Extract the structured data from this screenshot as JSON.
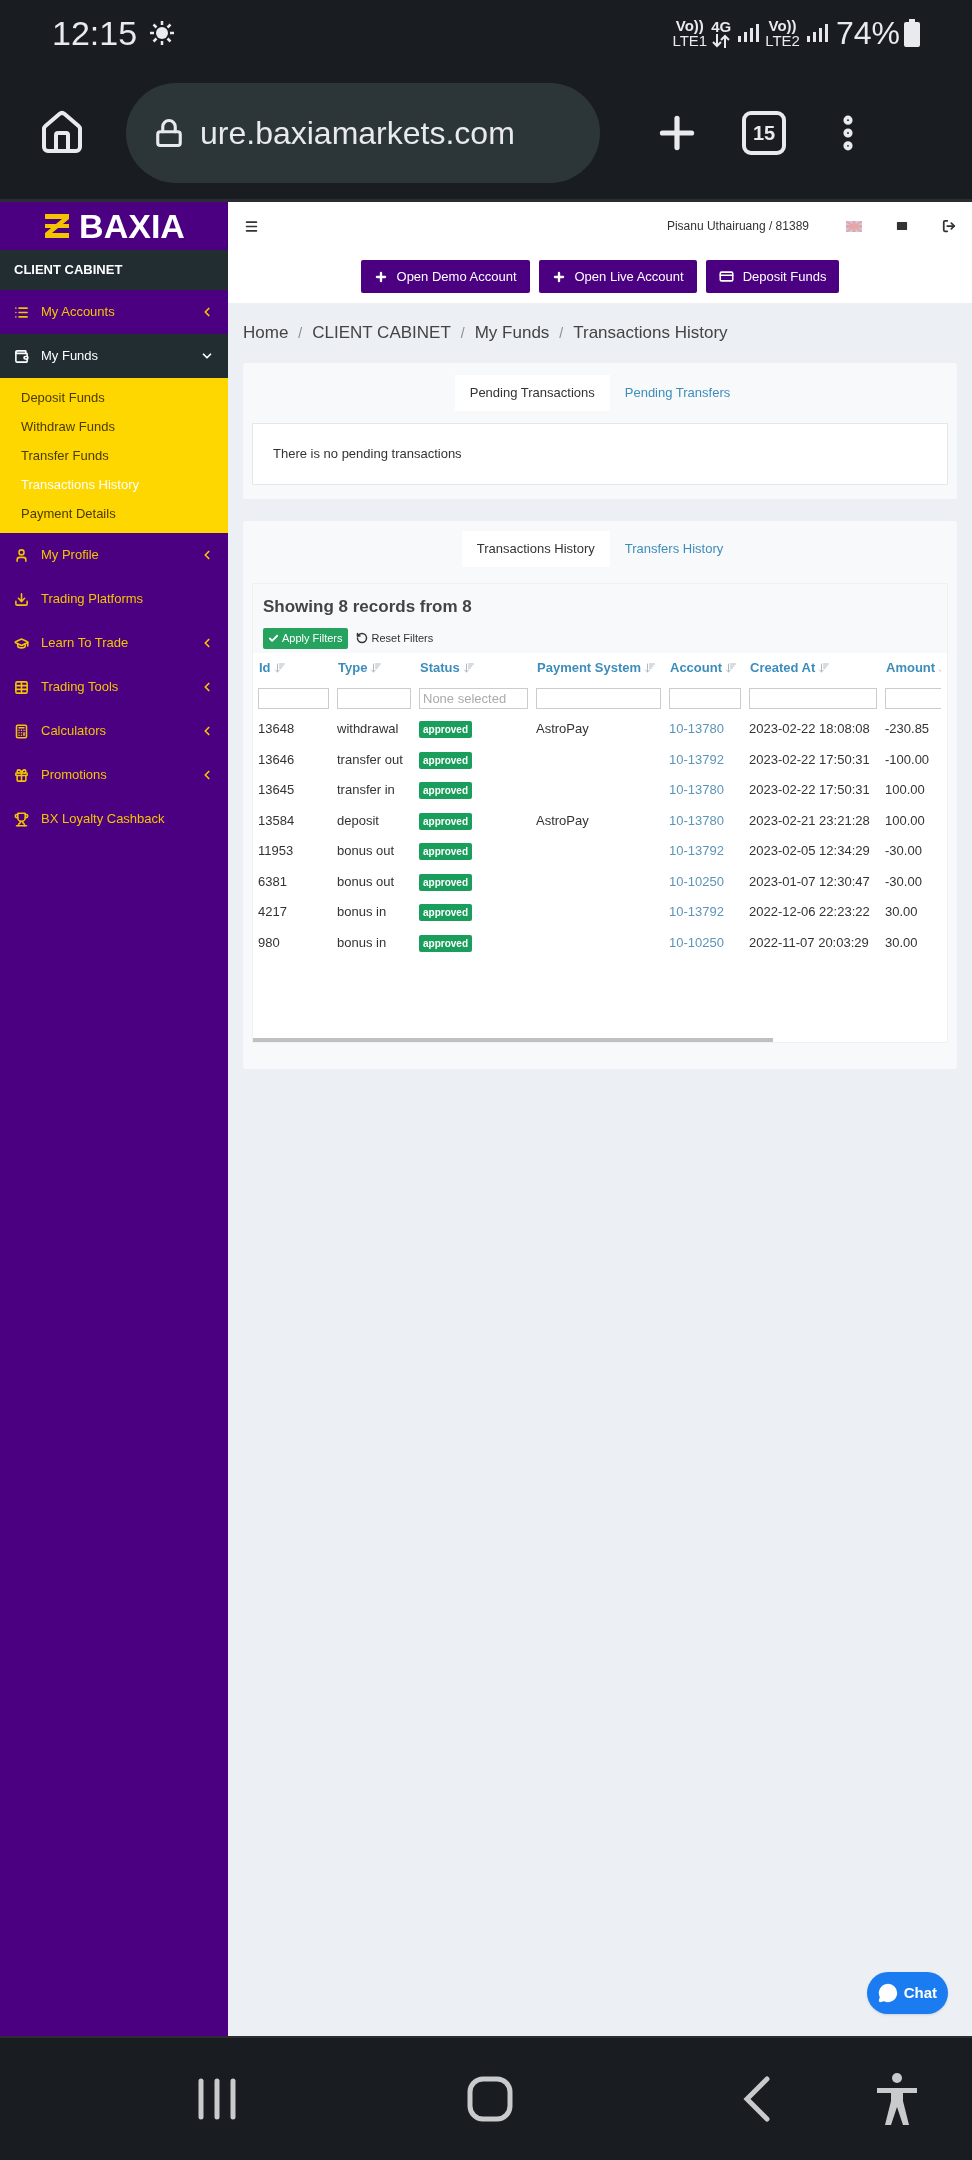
{
  "status_bar": {
    "time": "12:15",
    "indicators": [
      {
        "kind": "volte",
        "top": "Vo))",
        "bottom": "LTE1"
      },
      {
        "kind": "data",
        "top": "4G"
      },
      {
        "kind": "volte",
        "top": "Vo))",
        "bottom": "LTE2"
      }
    ],
    "battery": "74%"
  },
  "browser": {
    "url": "ure.baxiamarkets.com",
    "tab_count": "15"
  },
  "sidebar": {
    "logo": "BAXIA",
    "section": "CLIENT CABINET",
    "items": [
      {
        "kind": "group",
        "label": "My Accounts",
        "expanded": false
      },
      {
        "kind": "group",
        "label": "My Funds",
        "expanded": true,
        "children": [
          {
            "label": "Deposit Funds",
            "selected": false
          },
          {
            "label": "Withdraw Funds",
            "selected": false
          },
          {
            "label": "Transfer Funds",
            "selected": false
          },
          {
            "label": "Transactions History",
            "selected": true
          },
          {
            "label": "Payment Details",
            "selected": false
          }
        ]
      },
      {
        "kind": "group",
        "label": "My Profile",
        "expanded": false
      },
      {
        "kind": "link",
        "label": "Trading Platforms"
      },
      {
        "kind": "group",
        "label": "Learn To Trade",
        "expanded": false
      },
      {
        "kind": "group",
        "label": "Trading Tools",
        "expanded": false
      },
      {
        "kind": "group",
        "label": "Calculators",
        "expanded": false
      },
      {
        "kind": "group",
        "label": "Promotions",
        "expanded": false
      },
      {
        "kind": "link",
        "label": "BX Loyalty Cashback"
      }
    ]
  },
  "header": {
    "user": "Pisanu Uthairuang / 81389"
  },
  "actions": [
    {
      "kind": "plus",
      "label": "Open Demo Account"
    },
    {
      "kind": "plus",
      "label": "Open Live Account"
    },
    {
      "kind": "card",
      "label": "Deposit Funds"
    }
  ],
  "breadcrumb": {
    "separator": "/",
    "items": [
      "Home",
      "CLIENT CABINET",
      "My Funds",
      "Transactions History"
    ]
  },
  "pending": {
    "tabs": [
      {
        "label": "Pending Transactions",
        "selected": true
      },
      {
        "label": "Pending Transfers",
        "selected": false
      }
    ],
    "message": "There is no pending transactions"
  },
  "history": {
    "tabs": [
      {
        "label": "Transactions History",
        "selected": true
      },
      {
        "label": "Transfers History",
        "selected": false
      }
    ],
    "summary": "Showing 8 records from 8",
    "apply": "Apply Filters",
    "reset": "Reset Filters",
    "columns": [
      {
        "label": "Id",
        "kind": "text"
      },
      {
        "label": "Type",
        "kind": "text"
      },
      {
        "label": "Status",
        "kind": "select",
        "placeholder": "None selected"
      },
      {
        "label": "Payment System",
        "kind": "text"
      },
      {
        "label": "Account",
        "kind": "text"
      },
      {
        "label": "Created At",
        "kind": "text"
      },
      {
        "label": "Amount",
        "kind": "text"
      }
    ],
    "rows": [
      {
        "id": "13648",
        "type": "withdrawal",
        "status": "approved",
        "payment": "AstroPay",
        "account": "10-13780",
        "created": "2023-02-22 18:08:08",
        "amount": "-230.85"
      },
      {
        "id": "13646",
        "type": "transfer out",
        "status": "approved",
        "account": "10-13792",
        "created": "2023-02-22 17:50:31",
        "amount": "-100.00"
      },
      {
        "id": "13645",
        "type": "transfer in",
        "status": "approved",
        "account": "10-13780",
        "created": "2023-02-22 17:50:31",
        "amount": "100.00"
      },
      {
        "id": "13584",
        "type": "deposit",
        "status": "approved",
        "payment": "AstroPay",
        "account": "10-13780",
        "created": "2023-02-21 23:21:28",
        "amount": "100.00"
      },
      {
        "id": "11953",
        "type": "bonus out",
        "status": "approved",
        "account": "10-13792",
        "created": "2023-02-05 12:34:29",
        "amount": "-30.00"
      },
      {
        "id": "6381",
        "type": "bonus out",
        "status": "approved",
        "account": "10-10250",
        "created": "2023-01-07 12:30:47",
        "amount": "-30.00"
      },
      {
        "id": "4217",
        "type": "bonus in",
        "status": "approved",
        "account": "10-13792",
        "created": "2022-12-06 22:23:22",
        "amount": "30.00"
      },
      {
        "id": "980",
        "type": "bonus in",
        "status": "approved",
        "account": "10-10250",
        "created": "2022-11-07 20:03:29",
        "amount": "30.00"
      }
    ]
  },
  "chat": {
    "label": "Chat"
  }
}
